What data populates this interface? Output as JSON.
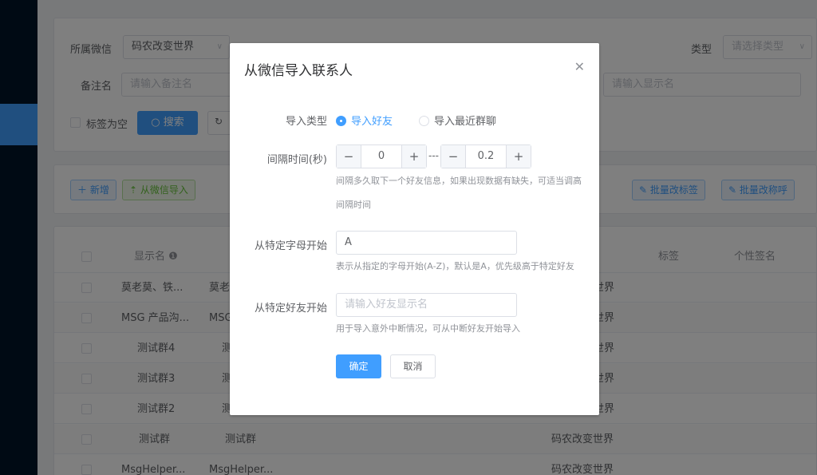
{
  "filters": {
    "wechat_label": "所属微信",
    "wechat_value": "码农改变世界",
    "remark_label": "备注名",
    "remark_placeholder": "请输入备注名",
    "type_label": "类型",
    "type_placeholder": "请选择类型",
    "display_placeholder": "请输入显示名",
    "empty_tag_label": "标签为空",
    "search_label": "搜索"
  },
  "toolbar": {
    "add_label": "新增",
    "import_label": "从微信导入",
    "batch_tag_label": "批量改标签",
    "batch_name_label": "批量改称呼"
  },
  "table": {
    "headers": {
      "display_name": "显示名",
      "tags": "标签",
      "signature": "个性签名"
    },
    "rows": [
      {
        "display": "莫老莫、铁...",
        "remark": "莫老",
        "wechat": "世界"
      },
      {
        "display": "MSG 产品沟...",
        "remark": "MSG",
        "wechat": "世界"
      },
      {
        "display": "测试群4",
        "remark": "测",
        "wechat": "世界"
      },
      {
        "display": "测试群3",
        "remark": "测",
        "wechat": "世界"
      },
      {
        "display": "测试群2",
        "remark": "测",
        "wechat": "世界"
      },
      {
        "display": "测试群",
        "remark": "测试群",
        "wechat": "码农改变世界"
      },
      {
        "display": "MsgHelper...",
        "remark": "MsgHelper...",
        "wechat": "码农改变世界"
      }
    ]
  },
  "dialog": {
    "title": "从微信导入联系人",
    "import_type_label": "导入类型",
    "opt_friends": "导入好友",
    "opt_groups": "导入最近群聊",
    "interval_label": "间隔时间(秒)",
    "interval_min": "0",
    "interval_max": "0.2",
    "interval_hint": "间隔多久取下一个好友信息，如果出现数据有缺失，可适当调高间隔时间",
    "letter_label": "从特定字母开始",
    "letter_value": "A",
    "letter_hint": "表示从指定的字母开始(A-Z)，默认是A，优先级高于特定好友",
    "friend_label": "从特定好友开始",
    "friend_placeholder": "请输入好友显示名",
    "friend_hint": "用于导入意外中断情况，可从中断好友开始导入",
    "ok_label": "确定",
    "cancel_label": "取消"
  }
}
